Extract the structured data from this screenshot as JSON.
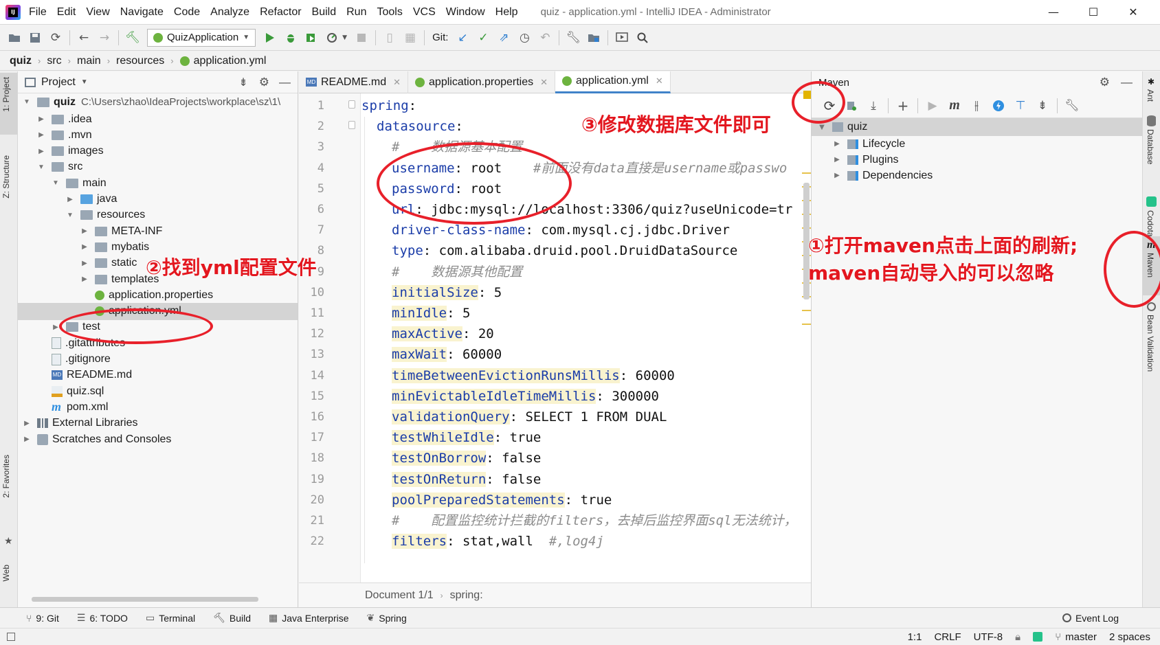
{
  "titlebar": {
    "menus": [
      "File",
      "Edit",
      "View",
      "Navigate",
      "Code",
      "Analyze",
      "Refactor",
      "Build",
      "Run",
      "Tools",
      "VCS",
      "Window",
      "Help"
    ],
    "title": "quiz - application.yml - IntelliJ IDEA - Administrator",
    "minimize": "—",
    "maximize": "☐",
    "close": "✕"
  },
  "toolbar": {
    "run_config": "QuizApplication",
    "git_label": "Git:"
  },
  "breadcrumb": [
    "quiz",
    "src",
    "main",
    "resources",
    "application.yml"
  ],
  "left_strip": {
    "project": "1: Project",
    "structure": "Z: Structure",
    "favorites": "2: Favorites",
    "web": "Web"
  },
  "project": {
    "header": "Project",
    "root_name": "quiz",
    "root_path": "C:\\Users\\zhao\\IdeaProjects\\workplace\\sz\\1\\",
    "items": [
      {
        "label": ".idea",
        "depth": 1,
        "arrow": "▶",
        "icon": "folder"
      },
      {
        "label": ".mvn",
        "depth": 1,
        "arrow": "▶",
        "icon": "folder"
      },
      {
        "label": "images",
        "depth": 1,
        "arrow": "▶",
        "icon": "folder"
      },
      {
        "label": "src",
        "depth": 1,
        "arrow": "▼",
        "icon": "folder"
      },
      {
        "label": "main",
        "depth": 2,
        "arrow": "▼",
        "icon": "folder"
      },
      {
        "label": "java",
        "depth": 3,
        "arrow": "▶",
        "icon": "folder-blue"
      },
      {
        "label": "resources",
        "depth": 3,
        "arrow": "▼",
        "icon": "folder"
      },
      {
        "label": "META-INF",
        "depth": 4,
        "arrow": "▶",
        "icon": "folder"
      },
      {
        "label": "mybatis",
        "depth": 4,
        "arrow": "▶",
        "icon": "folder"
      },
      {
        "label": "static",
        "depth": 4,
        "arrow": "▶",
        "icon": "folder"
      },
      {
        "label": "templates",
        "depth": 4,
        "arrow": "▶",
        "icon": "folder"
      },
      {
        "label": "application.properties",
        "depth": 4,
        "arrow": "",
        "icon": "spring-file"
      },
      {
        "label": "application.yml",
        "depth": 4,
        "arrow": "",
        "icon": "spring-file",
        "selected": true
      },
      {
        "label": "test",
        "depth": 2,
        "arrow": "▶",
        "icon": "folder"
      },
      {
        "label": ".gitattributes",
        "depth": 1,
        "arrow": "",
        "icon": "file"
      },
      {
        "label": ".gitignore",
        "depth": 1,
        "arrow": "",
        "icon": "file"
      },
      {
        "label": "README.md",
        "depth": 1,
        "arrow": "",
        "icon": "md-file"
      },
      {
        "label": "quiz.sql",
        "depth": 1,
        "arrow": "",
        "icon": "sql-file"
      },
      {
        "label": "pom.xml",
        "depth": 1,
        "arrow": "",
        "icon": "maven-file"
      },
      {
        "label": "External Libraries",
        "depth": 0,
        "arrow": "▶",
        "icon": "library"
      },
      {
        "label": "Scratches and Consoles",
        "depth": 0,
        "arrow": "▶",
        "icon": "scratch"
      }
    ]
  },
  "editor": {
    "tabs": [
      {
        "label": "README.md",
        "active": false
      },
      {
        "label": "application.properties",
        "active": false
      },
      {
        "label": "application.yml",
        "active": true
      }
    ],
    "lines": [
      {
        "n": "1",
        "indent": 0,
        "key": "spring",
        "sep": ":",
        "val": "",
        "comment": ""
      },
      {
        "n": "2",
        "indent": 1,
        "key": "datasource",
        "sep": ":",
        "val": "",
        "comment": ""
      },
      {
        "n": "3",
        "indent": 2,
        "key": "",
        "sep": "",
        "val": "",
        "comment": "#    数据源基本配置"
      },
      {
        "n": "4",
        "indent": 2,
        "key": "username",
        "sep": ": ",
        "val": "root",
        "comment": "    #前面没有data直接是username或passwo"
      },
      {
        "n": "5",
        "indent": 2,
        "key": "password",
        "sep": ": ",
        "val": "root",
        "comment": ""
      },
      {
        "n": "6",
        "indent": 2,
        "key": "url",
        "sep": ": ",
        "val": "jdbc:mysql://localhost:3306/quiz?useUnicode=tr",
        "comment": ""
      },
      {
        "n": "7",
        "indent": 2,
        "key": "driver-class-name",
        "sep": ": ",
        "val": "com.mysql.cj.jdbc.Driver",
        "comment": ""
      },
      {
        "n": "8",
        "indent": 2,
        "key": "type",
        "sep": ": ",
        "val": "com.alibaba.druid.pool.DruidDataSource",
        "comment": ""
      },
      {
        "n": "9",
        "indent": 2,
        "key": "",
        "sep": "",
        "val": "",
        "comment": "#    数据源其他配置"
      },
      {
        "n": "10",
        "indent": 2,
        "key": "initialSize",
        "sep": ": ",
        "val": "5",
        "comment": "",
        "hl": true
      },
      {
        "n": "11",
        "indent": 2,
        "key": "minIdle",
        "sep": ": ",
        "val": "5",
        "comment": "",
        "hl": true
      },
      {
        "n": "12",
        "indent": 2,
        "key": "maxActive",
        "sep": ": ",
        "val": "20",
        "comment": "",
        "hl": true
      },
      {
        "n": "13",
        "indent": 2,
        "key": "maxWait",
        "sep": ": ",
        "val": "60000",
        "comment": "",
        "hl": true
      },
      {
        "n": "14",
        "indent": 2,
        "key": "timeBetweenEvictionRunsMillis",
        "sep": ": ",
        "val": "60000",
        "comment": "",
        "hl": true
      },
      {
        "n": "15",
        "indent": 2,
        "key": "minEvictableIdleTimeMillis",
        "sep": ": ",
        "val": "300000",
        "comment": "",
        "hl": true
      },
      {
        "n": "16",
        "indent": 2,
        "key": "validationQuery",
        "sep": ": ",
        "val": "SELECT 1 FROM DUAL",
        "comment": "",
        "hl": true
      },
      {
        "n": "17",
        "indent": 2,
        "key": "testWhileIdle",
        "sep": ": ",
        "val": "true",
        "comment": "",
        "hl": true
      },
      {
        "n": "18",
        "indent": 2,
        "key": "testOnBorrow",
        "sep": ": ",
        "val": "false",
        "comment": "",
        "hl": true
      },
      {
        "n": "19",
        "indent": 2,
        "key": "testOnReturn",
        "sep": ": ",
        "val": "false",
        "comment": "",
        "hl": true
      },
      {
        "n": "20",
        "indent": 2,
        "key": "poolPreparedStatements",
        "sep": ": ",
        "val": "true",
        "comment": "",
        "hl": true
      },
      {
        "n": "21",
        "indent": 2,
        "key": "",
        "sep": "",
        "val": "",
        "comment": "#    配置监控统计拦截的filters，去掉后监控界面sql无法统计，"
      },
      {
        "n": "22",
        "indent": 2,
        "key": "filters",
        "sep": ": ",
        "val": "stat,wall",
        "comment": "  #,log4j",
        "hl": true
      }
    ],
    "status_doc": "Document 1/1",
    "status_path": "spring:"
  },
  "maven": {
    "title": "Maven",
    "root": "quiz",
    "children": [
      "Lifecycle",
      "Plugins",
      "Dependencies"
    ]
  },
  "right_strip": {
    "ant": "Ant",
    "database": "Database",
    "codota": "Codota",
    "maven": "Maven",
    "bean": "Bean Validation"
  },
  "tool_windows": [
    "9: Git",
    "6: TODO",
    "Terminal",
    "Build",
    "Java Enterprise",
    "Spring"
  ],
  "event_log": "Event Log",
  "status_bar": {
    "position": "1:1",
    "line_sep": "CRLF",
    "encoding": "UTF-8",
    "branch": "master",
    "indent": "2 spaces"
  },
  "annotations": {
    "step1_line1": "①打开maven点击上面的刷新;",
    "step1_line2": "maven自动导入的可以忽略",
    "step2": "②找到yml配置文件",
    "step3": "③修改数据库文件即可"
  },
  "colors": {
    "annotation_red": "#e8202a",
    "key_blue": "#1a3ca8",
    "tab_active": "#4083c9",
    "selected_row": "#d4d4d4",
    "run_green": "#3a9a3a"
  }
}
